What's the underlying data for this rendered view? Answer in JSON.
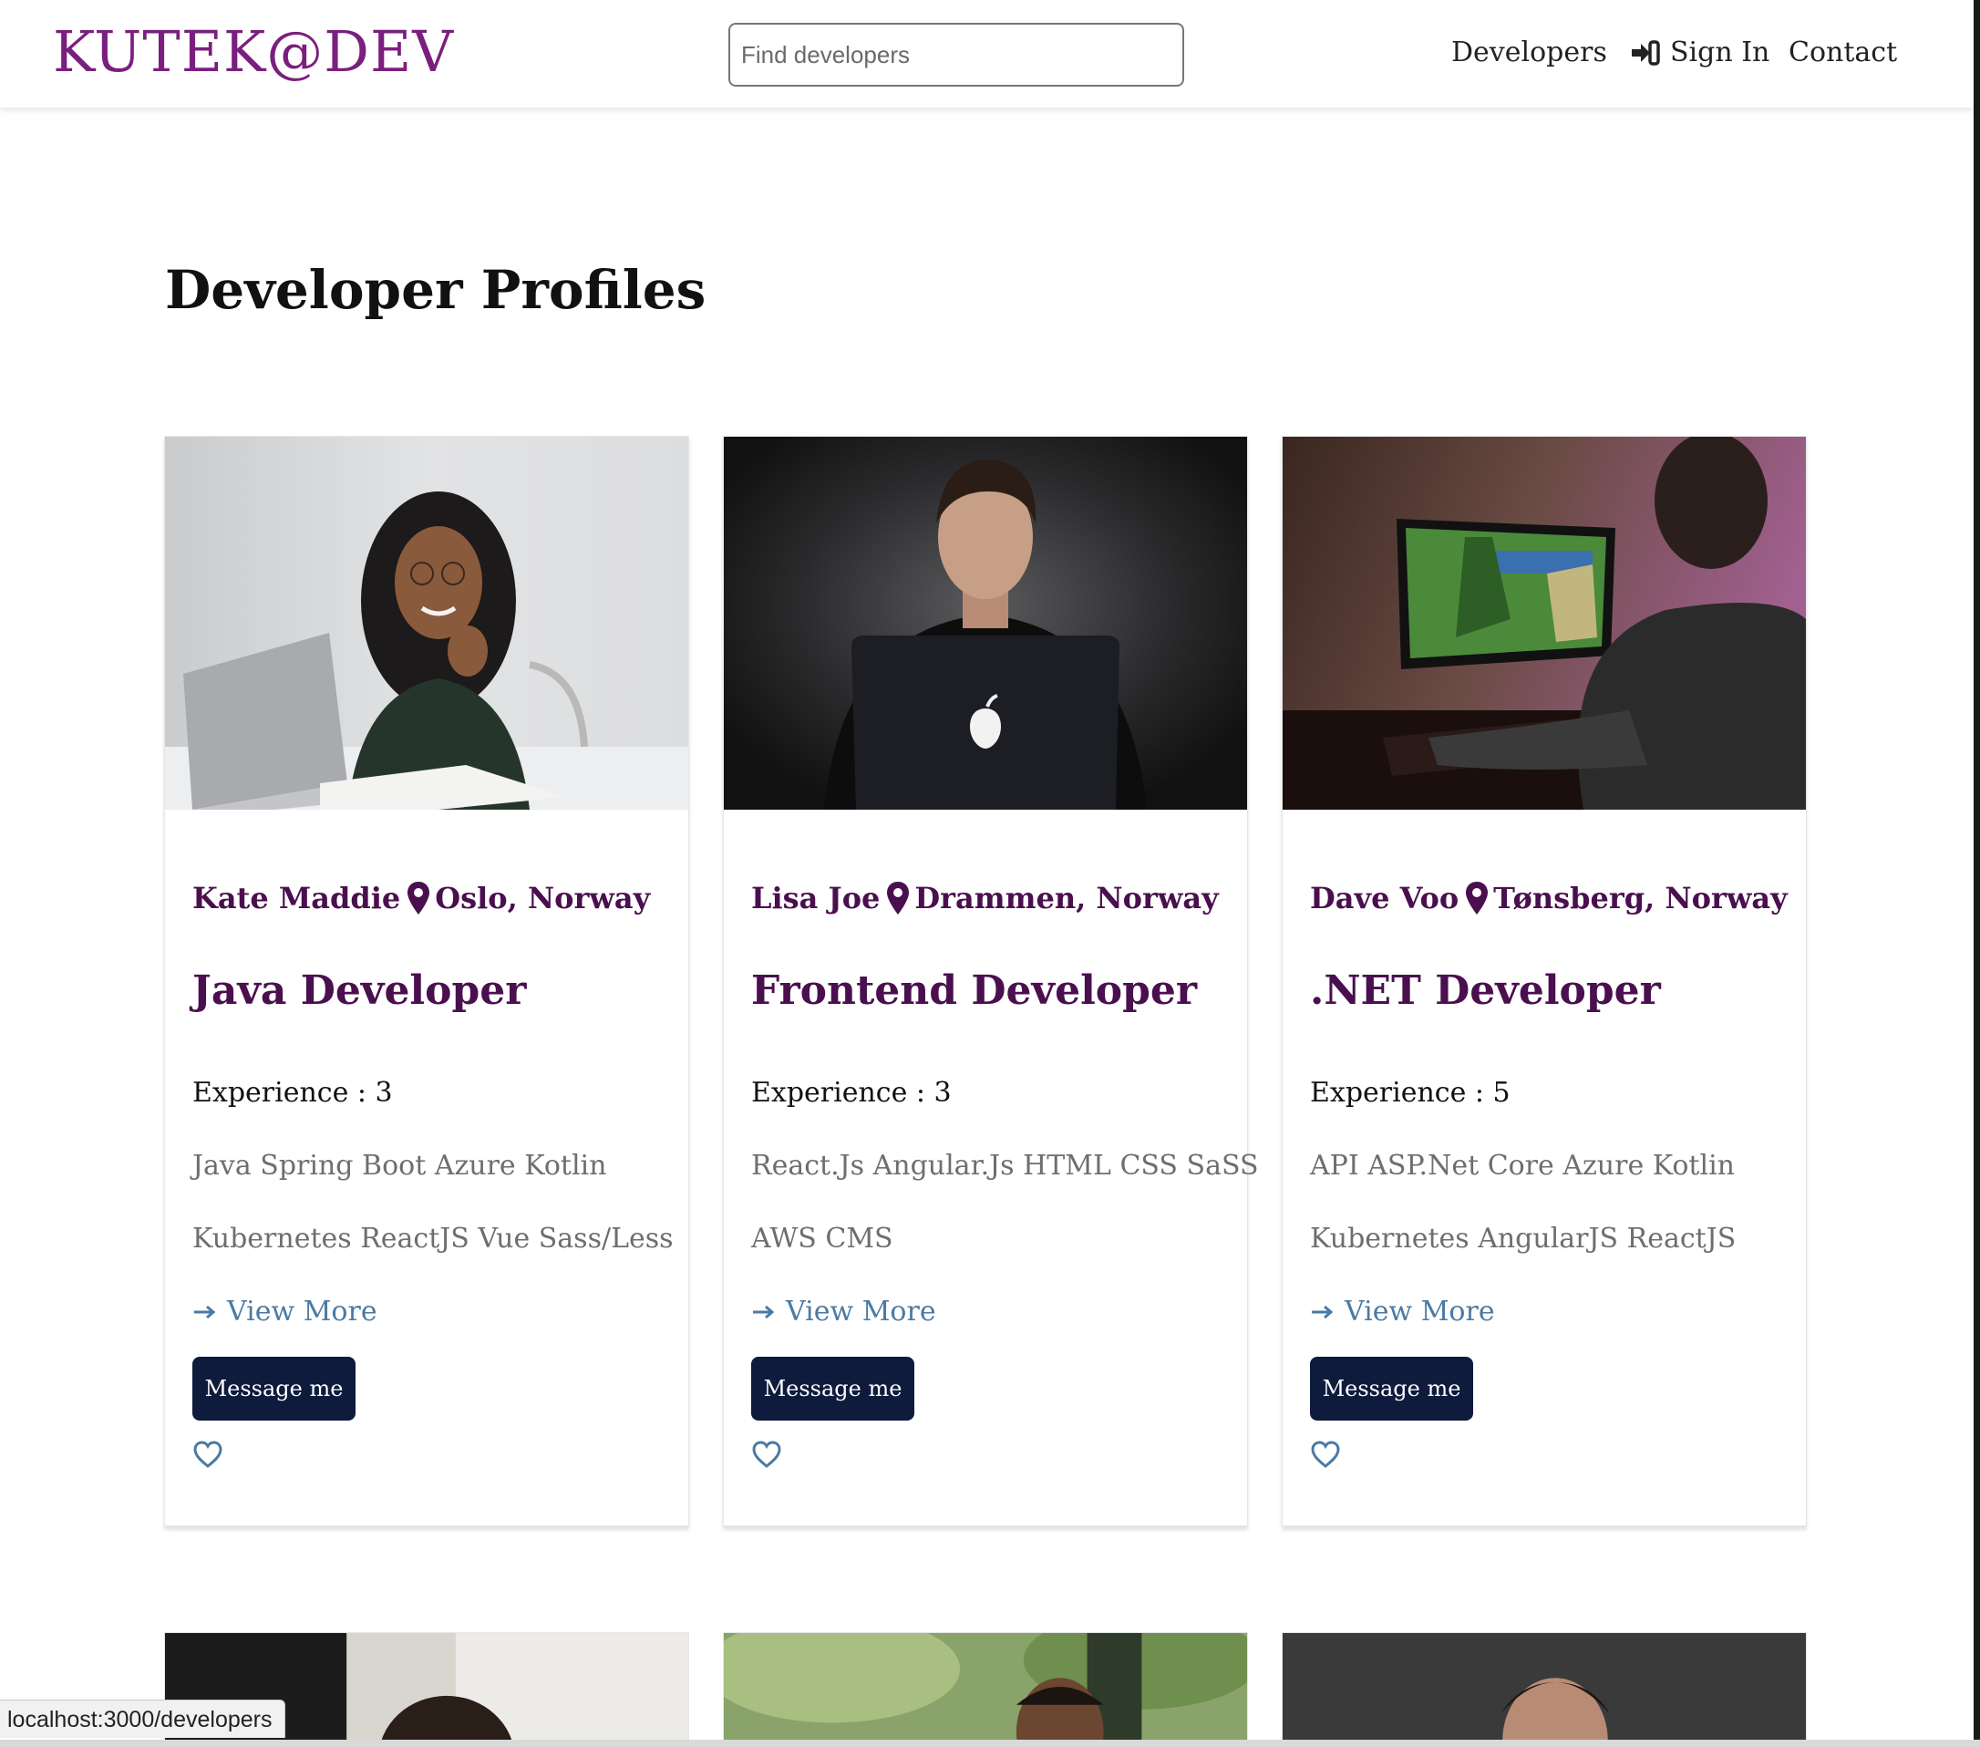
{
  "header": {
    "logo": "KUTEK@DEV",
    "search_placeholder": "Find developers",
    "nav": {
      "developers": "Developers",
      "signin": "Sign In",
      "contact": "Contact"
    }
  },
  "page_title": "Developer Profiles",
  "cards": [
    {
      "name": "Kate Maddie",
      "location": "Oslo, Norway",
      "role": "Java Developer",
      "experience": "Experience : 3",
      "skills_line1": "Java Spring Boot Azure Kotlin",
      "skills_line2": "Kubernetes ReactJS Vue Sass/Less",
      "view_more": "View More",
      "message_button": "Message me"
    },
    {
      "name": "Lisa Joe",
      "location": "Drammen, Norway",
      "role": "Frontend Developer",
      "experience": "Experience : 3",
      "skills_line1": "React.Js Angular.Js HTML CSS SaSS",
      "skills_line2": "AWS CMS",
      "view_more": "View More",
      "message_button": "Message me"
    },
    {
      "name": "Dave Voo",
      "location": "Tønsberg, Norway",
      "role": ".NET Developer",
      "experience": "Experience : 5",
      "skills_line1": "API ASP.Net Core Azure Kotlin",
      "skills_line2": "Kubernetes AngularJS ReactJS",
      "view_more": "View More",
      "message_button": "Message me"
    }
  ],
  "status_bar": "localhost:3000/developers",
  "colors": {
    "brand": "#7a1f7e",
    "card_heading": "#4a0f4e",
    "link": "#4b7aa3",
    "button_bg": "#0f1b3d"
  },
  "icons": {
    "signin": "sign-in-icon",
    "location": "map-pin-icon",
    "view_more": "arrow-right-icon",
    "favorite": "heart-outline-icon"
  }
}
